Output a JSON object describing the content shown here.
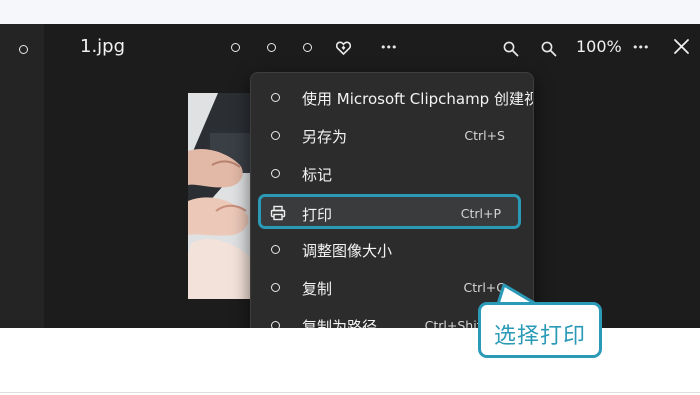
{
  "toolbar": {
    "file_name": "1.jpg",
    "zoom_level": "100%",
    "more_label": "•••"
  },
  "menu": {
    "items": [
      {
        "label": "使用 Microsoft Clipchamp 创建视频",
        "shortcut": ""
      },
      {
        "label": "另存为",
        "shortcut": "Ctrl+S"
      },
      {
        "label": "标记",
        "shortcut": ""
      },
      {
        "label": "打印",
        "shortcut": "Ctrl+P",
        "icon": "printer-icon",
        "highlighted": true
      },
      {
        "label": "调整图像大小",
        "shortcut": ""
      },
      {
        "label": "复制",
        "shortcut": "Ctrl+C"
      },
      {
        "label": "复制为路径",
        "shortcut": "Ctrl+Shift+C"
      }
    ]
  },
  "callout": {
    "text": "选择打印"
  },
  "colors": {
    "accent": "#2a9ab7",
    "menu_bg": "#2c2c2c",
    "app_bg": "#1c1c1c"
  }
}
